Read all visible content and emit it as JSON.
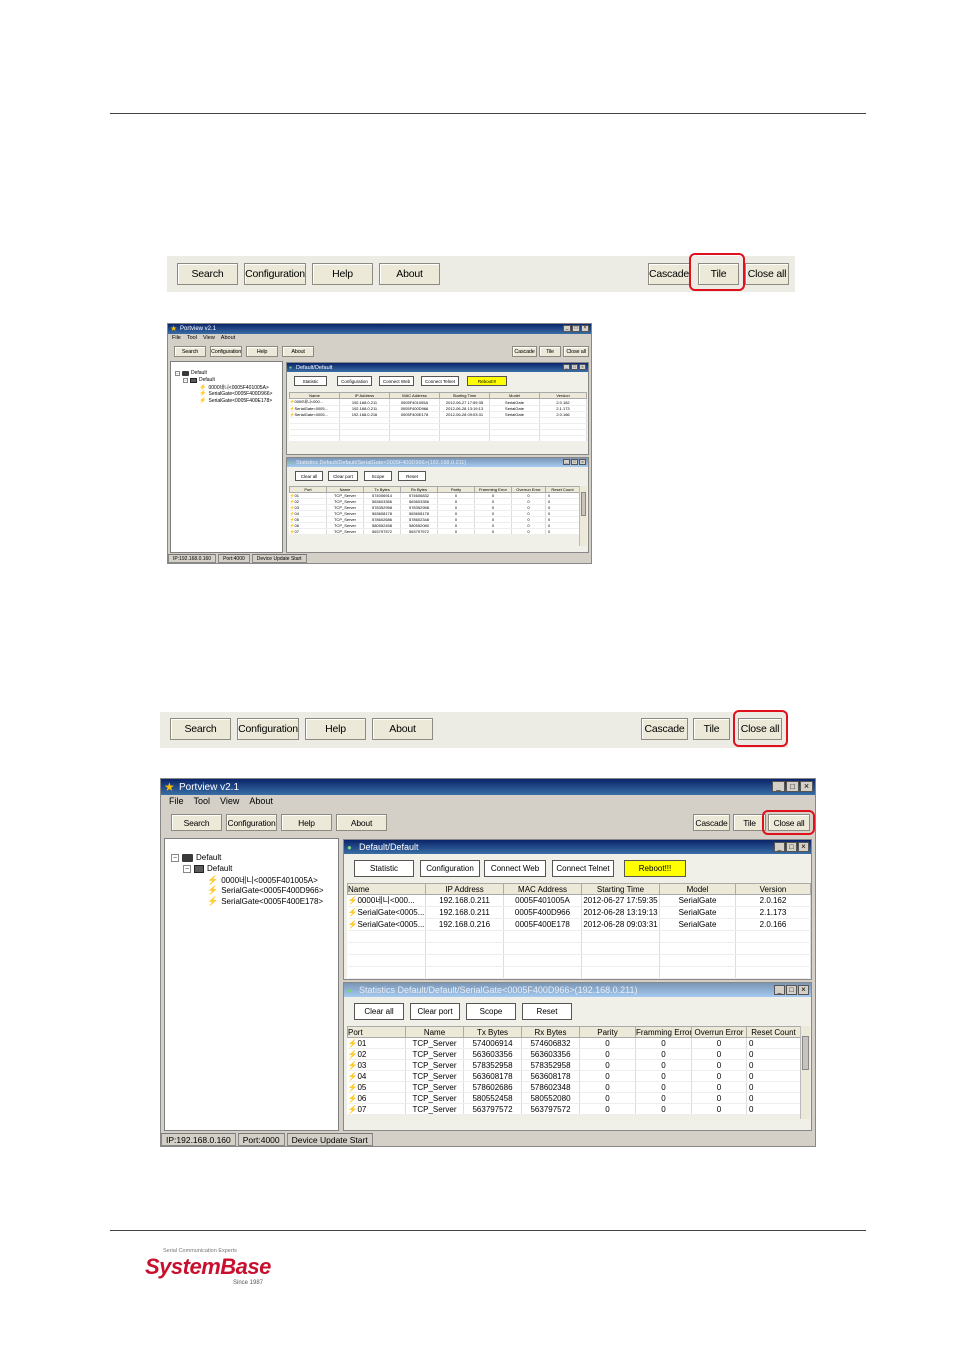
{
  "toolbar": {
    "search": "Search",
    "configuration": "Configuration",
    "help": "Help",
    "about": "About",
    "cascade": "Cascade",
    "tile": "Tile",
    "close_all": "Close all"
  },
  "app": {
    "title": "Portview v2.1",
    "menu": [
      "File",
      "Tool",
      "View",
      "About"
    ],
    "tree": {
      "root": "Default",
      "group": "Default",
      "devices": [
        "0000네니<0005F401005A>",
        "SerialGate<0005F400D966>",
        "SerialGate<0005F400E178>"
      ]
    },
    "device_window": {
      "title": "Default/Default",
      "buttons": [
        "Statistic",
        "Configuration",
        "Connect Web",
        "Connect Telnet",
        "Reboot!!!"
      ],
      "columns": [
        "Name",
        "IP Address",
        "MAC Address",
        "Starting Time",
        "Model",
        "Version"
      ],
      "rows": [
        [
          "0000네니<000...",
          "192.168.0.211",
          "0005F401005A",
          "2012-06-27 17:59:35",
          "SerialGate",
          "2.0.162"
        ],
        [
          "SerialGate<0005...",
          "192.168.0.211",
          "0005F400D966",
          "2012-06-28 13:19:13",
          "SerialGate",
          "2.1.173"
        ],
        [
          "SerialGate<0005...",
          "192.168.0.216",
          "0005F400E178",
          "2012-06-28 09:03:31",
          "SerialGate",
          "2.0.166"
        ]
      ]
    },
    "stats_window": {
      "title": "Statistics Default/Default/SerialGate<0005F400D966>(192.168.0.211)",
      "buttons": [
        "Clear all",
        "Clear port",
        "Scope",
        "Reset"
      ],
      "columns": [
        "Port",
        "Name",
        "Tx Bytes",
        "Rx Bytes",
        "Parity",
        "Framming Error",
        "Overrun Error",
        "Reset Count"
      ],
      "rows": [
        [
          "01",
          "TCP_Server",
          "574006914",
          "574606832",
          "0",
          "0",
          "0",
          "0"
        ],
        [
          "02",
          "TCP_Server",
          "563603356",
          "563603356",
          "0",
          "0",
          "0",
          "0"
        ],
        [
          "03",
          "TCP_Server",
          "578352958",
          "578352958",
          "0",
          "0",
          "0",
          "0"
        ],
        [
          "04",
          "TCP_Server",
          "563608178",
          "563608178",
          "0",
          "0",
          "0",
          "0"
        ],
        [
          "05",
          "TCP_Server",
          "578602686",
          "578602348",
          "0",
          "0",
          "0",
          "0"
        ],
        [
          "06",
          "TCP_Server",
          "580552458",
          "580552080",
          "0",
          "0",
          "0",
          "0"
        ],
        [
          "07",
          "TCP_Server",
          "563797572",
          "563797572",
          "0",
          "0",
          "0",
          "0"
        ]
      ]
    },
    "status": [
      "IP:192.168.0.160",
      "Port:4000",
      "Device Update Start"
    ]
  },
  "logo": {
    "tagline": "Serial Communication Experts",
    "name": "SystemBase",
    "since": "Since 1987"
  },
  "colors": {
    "highlight": "#e0101c",
    "brand": "#c8102e",
    "reboot": "#ffff00"
  }
}
